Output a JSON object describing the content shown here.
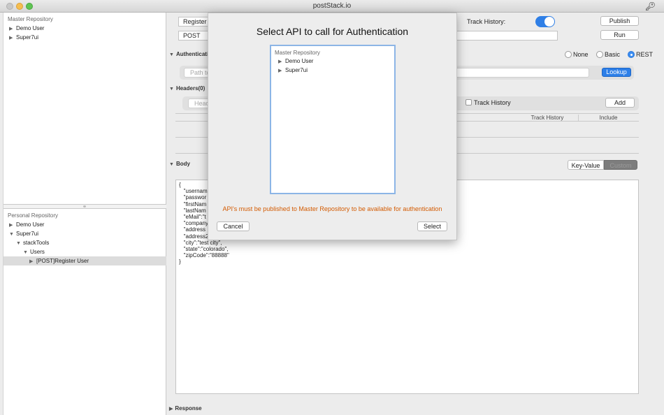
{
  "window": {
    "title": "postStack.io",
    "key_icon": "key-icon"
  },
  "left_panel": {
    "master": {
      "header": "Master Repository",
      "items": [
        {
          "label": "Demo User"
        },
        {
          "label": "Super7ui"
        }
      ]
    },
    "personal": {
      "header": "Personal Repository",
      "items": [
        {
          "label": "Demo User",
          "indent": 0,
          "arrow": "▶"
        },
        {
          "label": "Super7ui",
          "indent": 0,
          "arrow": "▼"
        },
        {
          "label": "stackTools",
          "indent": 1,
          "arrow": "▼"
        },
        {
          "label": "Users",
          "indent": 2,
          "arrow": "▼"
        },
        {
          "label": "[POST]Register User",
          "indent": 3,
          "arrow": "▶",
          "selected": true
        }
      ]
    }
  },
  "main": {
    "api_name": "Register",
    "method": "POST",
    "track_history_label": "Track History:",
    "publish_label": "Publish",
    "run_label": "Run",
    "auth_section": "Authenticati",
    "auth_options": [
      {
        "label": "None"
      },
      {
        "label": "Basic"
      },
      {
        "label": "REST",
        "selected": true
      }
    ],
    "path_placeholder": "Path to",
    "lookup_label": "Lookup",
    "headers_section": "Headers(0)",
    "header_placeholder": "Head",
    "headers_track_history": "Track History",
    "add_label": "Add",
    "col_track_history": "Track History",
    "col_include": "Include",
    "body_section": "Body",
    "body_mode_keyvalue": "Key-Value",
    "body_mode_custom": "Custom",
    "body_lines": [
      "{",
      "   \"usernam",
      "   \"passwor",
      "   \"firstNam",
      "   \"lastNam",
      "   \"eMail\":\"t",
      "   \"company",
      "   \"address",
      "   \"address2",
      "   \"city\":\"test city\",",
      "   \"state\":\"colorado\",",
      "   \"zipCode\":\"88888\"",
      "}"
    ],
    "response_section": "Response"
  },
  "modal": {
    "title": "Select API to call for Authentication",
    "tree_header": "Master Repository",
    "tree_items": [
      {
        "label": "Demo User"
      },
      {
        "label": "Super7ui"
      }
    ],
    "message": "API's must be published to Master Repository to be available for authentication",
    "cancel_label": "Cancel",
    "select_label": "Select"
  },
  "colors": {
    "accent": "#2f7fe6",
    "warning_text": "#d35a00"
  }
}
